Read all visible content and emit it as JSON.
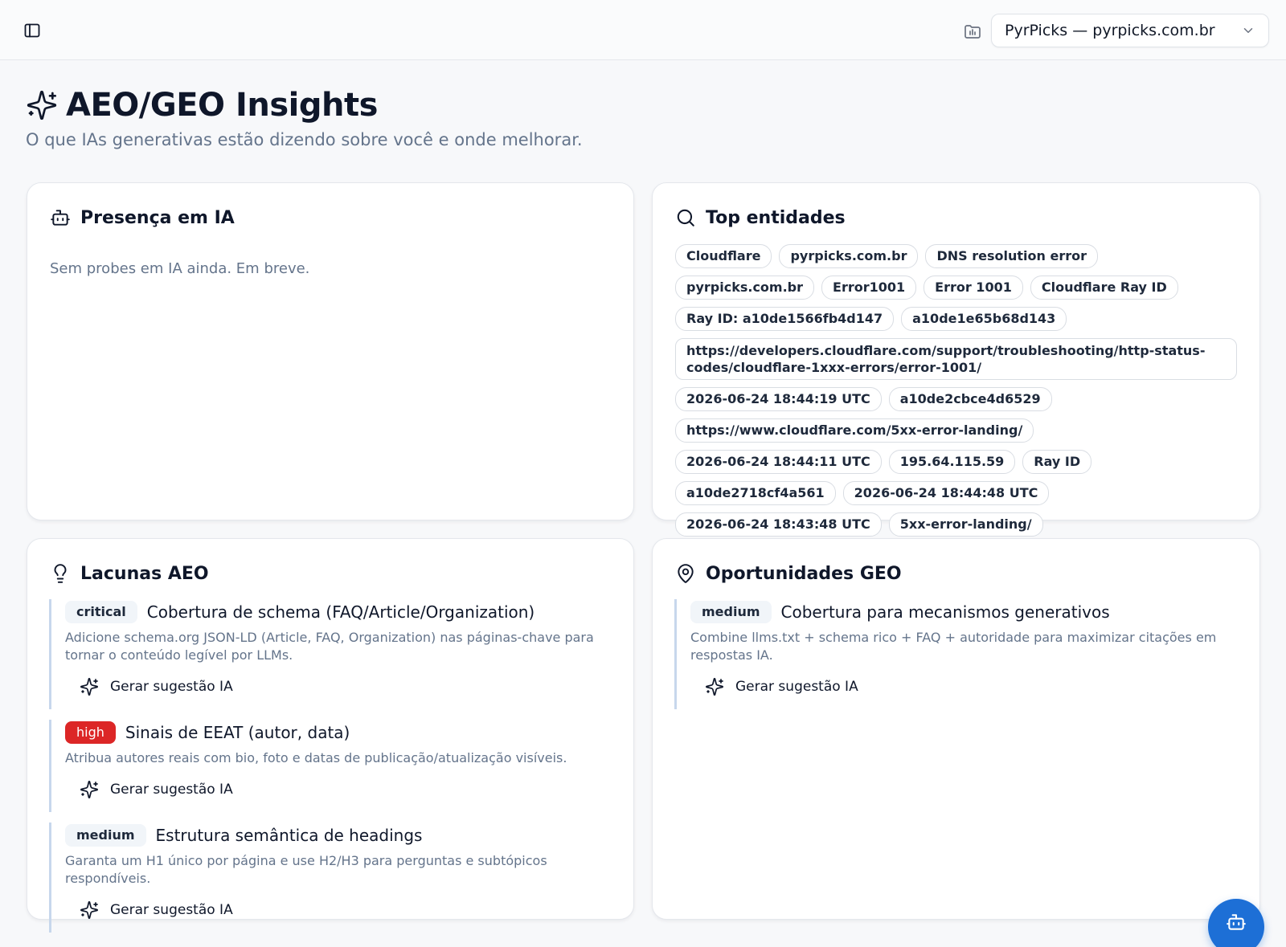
{
  "topbar": {
    "site_selector": {
      "value": "PyrPicks — pyrpicks.com.br"
    }
  },
  "page": {
    "title": "AEO/GEO Insights",
    "subtitle": "O que IAs generativas estão dizendo sobre você e onde melhorar."
  },
  "presence": {
    "title": "Presença em IA",
    "empty": "Sem probes em IA ainda. Em breve."
  },
  "entities": {
    "title": "Top entidades",
    "items": [
      "Cloudflare",
      "pyrpicks.com.br",
      "DNS resolution error",
      "pyrpicks.com.br",
      "Error1001",
      "Error 1001",
      "Cloudflare Ray ID",
      "Ray ID: a10de1566fb4d147",
      "a10de1e65b68d143",
      "https://developers.cloudflare.com/support/troubleshooting/http-status-codes/cloudflare-1xxx-errors/error-1001/",
      "2026-06-24 18:44:19 UTC",
      "a10de2cbce4d6529",
      "https://www.cloudflare.com/5xx-error-landing/",
      "2026-06-24 18:44:11 UTC",
      "195.64.115.59",
      "Ray ID",
      "a10de2718cf4a561",
      "2026-06-24 18:44:48 UTC",
      "2026-06-24 18:43:48 UTC",
      "5xx-error-landing/"
    ]
  },
  "gaps": {
    "title": "Lacunas AEO",
    "items": [
      {
        "severity": "critical",
        "title": "Cobertura de schema (FAQ/Article/Organization)",
        "description": "Adicione schema.org JSON-LD (Article, FAQ, Organization) nas páginas-chave para tornar o conteúdo legível por LLMs.",
        "action": "Gerar sugestão IA"
      },
      {
        "severity": "high",
        "title": "Sinais de EEAT (autor, data)",
        "description": "Atribua autores reais com bio, foto e datas de publicação/atualização visíveis.",
        "action": "Gerar sugestão IA"
      },
      {
        "severity": "medium",
        "title": "Estrutura semântica de headings",
        "description": "Garanta um H1 único por página e use H2/H3 para perguntas e subtópicos respondíveis.",
        "action": "Gerar sugestão IA"
      }
    ]
  },
  "geo": {
    "title": "Oportunidades GEO",
    "items": [
      {
        "severity": "medium",
        "title": "Cobertura para mecanismos generativos",
        "description": "Combine llms.txt + schema rico + FAQ + autoridade para maximizar citações em respostas IA.",
        "action": "Gerar sugestão IA"
      }
    ]
  },
  "icons": {
    "sidebar_toggle": "panel-left-icon",
    "site": "folder-icon",
    "title": "sparkles-icon",
    "presence": "bot-icon",
    "entities": "search-icon",
    "gaps": "lightbulb-icon",
    "geo": "map-pin-icon",
    "fab": "bot-icon"
  },
  "colors": {
    "accent": "#1d6fd6",
    "high": "#dc2626",
    "item_border": "#c7d7ec"
  }
}
